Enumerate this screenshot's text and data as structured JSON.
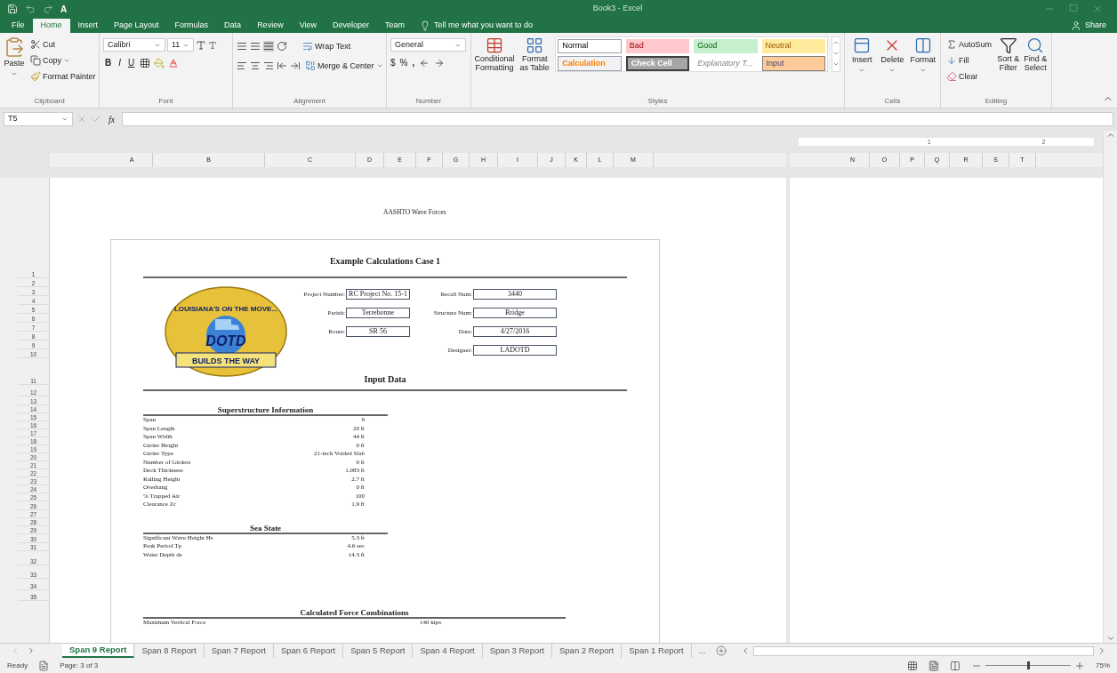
{
  "window": {
    "title": "Book3 - Excel",
    "quick_access_label": "A"
  },
  "menu_tabs": [
    {
      "label": "File",
      "selected": false
    },
    {
      "label": "Home",
      "selected": true
    },
    {
      "label": "Insert",
      "selected": false
    },
    {
      "label": "Page Layout",
      "selected": false
    },
    {
      "label": "Formulas",
      "selected": false
    },
    {
      "label": "Data",
      "selected": false
    },
    {
      "label": "Review",
      "selected": false
    },
    {
      "label": "View",
      "selected": false
    },
    {
      "label": "Developer",
      "selected": false
    },
    {
      "label": "Team",
      "selected": false
    }
  ],
  "tell_me": "Tell me what you want to do",
  "share": "Share",
  "ribbon": {
    "clipboard": {
      "paste": "Paste",
      "cut": "Cut",
      "copy": "Copy",
      "format_painter": "Format Painter",
      "label": "Clipboard"
    },
    "font": {
      "name": "Calibri",
      "size": "11",
      "bold": "B",
      "italic": "I",
      "underline": "U",
      "label": "Font"
    },
    "alignment": {
      "wrap_text": "Wrap Text",
      "merge_center": "Merge & Center",
      "label": "Alignment"
    },
    "number": {
      "format": "General",
      "currency": "$",
      "percent": "%",
      "comma": ",",
      "label": "Number"
    },
    "styles": {
      "conditional_formatting": "Conditional Formatting",
      "format_as_table": "Format as Table",
      "label": "Styles",
      "cell_styles": [
        {
          "label": "Normal",
          "kind": "normal"
        },
        {
          "label": "Bad",
          "kind": "bad"
        },
        {
          "label": "Good",
          "kind": "good"
        },
        {
          "label": "Neutral",
          "kind": "neutral"
        },
        {
          "label": "Calculation",
          "kind": "calculation"
        },
        {
          "label": "Check Cell",
          "kind": "check"
        },
        {
          "label": "Explanatory T...",
          "kind": "explanatory"
        },
        {
          "label": "Input",
          "kind": "input"
        }
      ]
    },
    "cells": {
      "buttons": [
        "Insert",
        "Delete",
        "Format"
      ],
      "label": "Cells"
    },
    "editing": {
      "autosum": "AutoSum",
      "fill": "Fill",
      "clear": "Clear",
      "sort_filter": "Sort & Filter",
      "find_select": "Find & Select",
      "label": "Editing"
    }
  },
  "formula_bar": {
    "name_box": "T5",
    "function_label": "fx"
  },
  "columns_left": [
    "A",
    "B",
    "C",
    "D",
    "E",
    "F",
    "G",
    "H",
    "I",
    "J",
    "K",
    "L",
    "M"
  ],
  "columns_right": [
    "N",
    "O",
    "P",
    "Q",
    "R",
    "S",
    "T"
  ],
  "ruler_marks": [
    "1",
    "2"
  ],
  "rows": [
    "1",
    "2",
    "3",
    "4",
    "5",
    "6",
    "7",
    "8",
    "9",
    "10",
    "11",
    "12",
    "13",
    "14",
    "15",
    "16",
    "17",
    "18",
    "19",
    "20",
    "21",
    "22",
    "23",
    "24",
    "25",
    "26",
    "27",
    "28",
    "29",
    "30",
    "31",
    "32",
    "33",
    "34",
    "35"
  ],
  "report": {
    "page_header": "AASHTO Wave Forces",
    "title": "Example Calculations Case 1",
    "logo": {
      "arc_text": "LOUISIANA'S ON THE MOVE...",
      "center_text": "DOTD",
      "banner_text": "BUILDS THE WAY"
    },
    "fields_left": [
      {
        "label": "Project Number:",
        "value": "RC Project No. 15-1"
      },
      {
        "label": "Parish:",
        "value": "Terrebonne"
      },
      {
        "label": "Route:",
        "value": "SR 56"
      }
    ],
    "fields_right": [
      {
        "label": "Recall Num:",
        "value": "3440"
      },
      {
        "label": "Structure Num:",
        "value": "Bridge"
      },
      {
        "label": "Date:",
        "value": "4/27/2016"
      },
      {
        "label": "Designer:",
        "value": "LADOTD"
      }
    ],
    "input_title": "Input Data",
    "sections": [
      {
        "kind": "narrow",
        "title": "Superstructure Information",
        "rows": [
          {
            "label": "Span",
            "value": "9"
          },
          {
            "label": "Span Length",
            "value": "20 ft"
          },
          {
            "label": "Span Width",
            "value": "44 ft"
          },
          {
            "label": "Girder Height",
            "value": "0 ft"
          },
          {
            "label": "Girder Type",
            "value": "21-inch Voided Slab"
          },
          {
            "label": "Number of Girders",
            "value": "0 ft"
          },
          {
            "label": "Deck Thickness",
            "value": "1.083 ft"
          },
          {
            "label": "Railing Height",
            "value": "2.7 ft"
          },
          {
            "label": "Overhang",
            "value": "0 ft"
          },
          {
            "label": "% Trapped Air",
            "value": "100"
          },
          {
            "label": "Clearance Zc",
            "value": "1.9 ft"
          }
        ]
      },
      {
        "kind": "narrow",
        "title": "Sea State",
        "rows": [
          {
            "label": "Significant Wave Height Hs",
            "value": "5.3 ft"
          },
          {
            "label": "Peak Period Tp",
            "value": "4.6 sec"
          },
          {
            "label": "Water Depth ds",
            "value": "14.3 ft"
          }
        ]
      },
      {
        "kind": "wide",
        "title": "Calculated Force Combinations",
        "rows": [
          {
            "label": "Maximum Vertical Force",
            "value": "140 kips"
          }
        ]
      }
    ]
  },
  "sheet_tabs": [
    {
      "label": "Span 9 Report",
      "selected": true
    },
    {
      "label": "Span 8 Report",
      "selected": false
    },
    {
      "label": "Span 7 Report",
      "selected": false
    },
    {
      "label": "Span 6 Report",
      "selected": false
    },
    {
      "label": "Span 5 Report",
      "selected": false
    },
    {
      "label": "Span 4 Report",
      "selected": false
    },
    {
      "label": "Span 3 Report",
      "selected": false
    },
    {
      "label": "Span 2 Report",
      "selected": false
    },
    {
      "label": "Span 1 Report",
      "selected": false
    }
  ],
  "more_tabs": "...",
  "status": {
    "state": "Ready",
    "page": "Page: 3 of 3",
    "zoom": "75%",
    "zoom_level": {
      "level": 0.5
    }
  }
}
